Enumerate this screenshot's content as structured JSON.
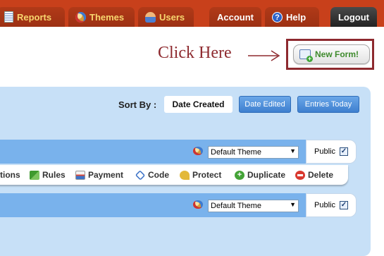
{
  "nav": {
    "left_tabs": [
      {
        "label": "Reports",
        "icon": "reports-icon"
      },
      {
        "label": "Themes",
        "icon": "themes-icon"
      },
      {
        "label": "Users",
        "icon": "users-icon"
      }
    ],
    "account_label": "Account",
    "help_label": "Help",
    "logout_label": "Logout"
  },
  "callout": {
    "text": "Click Here",
    "arrow": "—→"
  },
  "new_form": {
    "label": "New Form!",
    "icon": "new-form-icon"
  },
  "sort": {
    "label": "Sort By :",
    "options": [
      "Date Created",
      "Date Edited",
      "Entries Today"
    ],
    "selected": "Date Created"
  },
  "forms": [
    {
      "theme": "Default Theme",
      "public_label": "Public",
      "public_checked": true
    },
    {
      "theme": "Default Theme",
      "public_label": "Public",
      "public_checked": true
    }
  ],
  "actions": [
    {
      "label": "tions",
      "icon": ""
    },
    {
      "label": "Rules",
      "icon": "rules-icon"
    },
    {
      "label": "Payment",
      "icon": "payment-icon"
    },
    {
      "label": "Code",
      "icon": "code-icon"
    },
    {
      "label": "Protect",
      "icon": "protect-icon"
    },
    {
      "label": "Duplicate",
      "icon": "duplicate-icon"
    },
    {
      "label": "Delete",
      "icon": "delete-icon"
    }
  ],
  "colors": {
    "nav_bg": "#c8401b",
    "nav_tab_text": "#f8d66e",
    "callout": "#8e2a2f",
    "new_form_text": "#3e8a2c",
    "panel_bg": "#c7e0f7",
    "row_bg": "#79b2ec",
    "sort_button": "#4a8ad8"
  }
}
